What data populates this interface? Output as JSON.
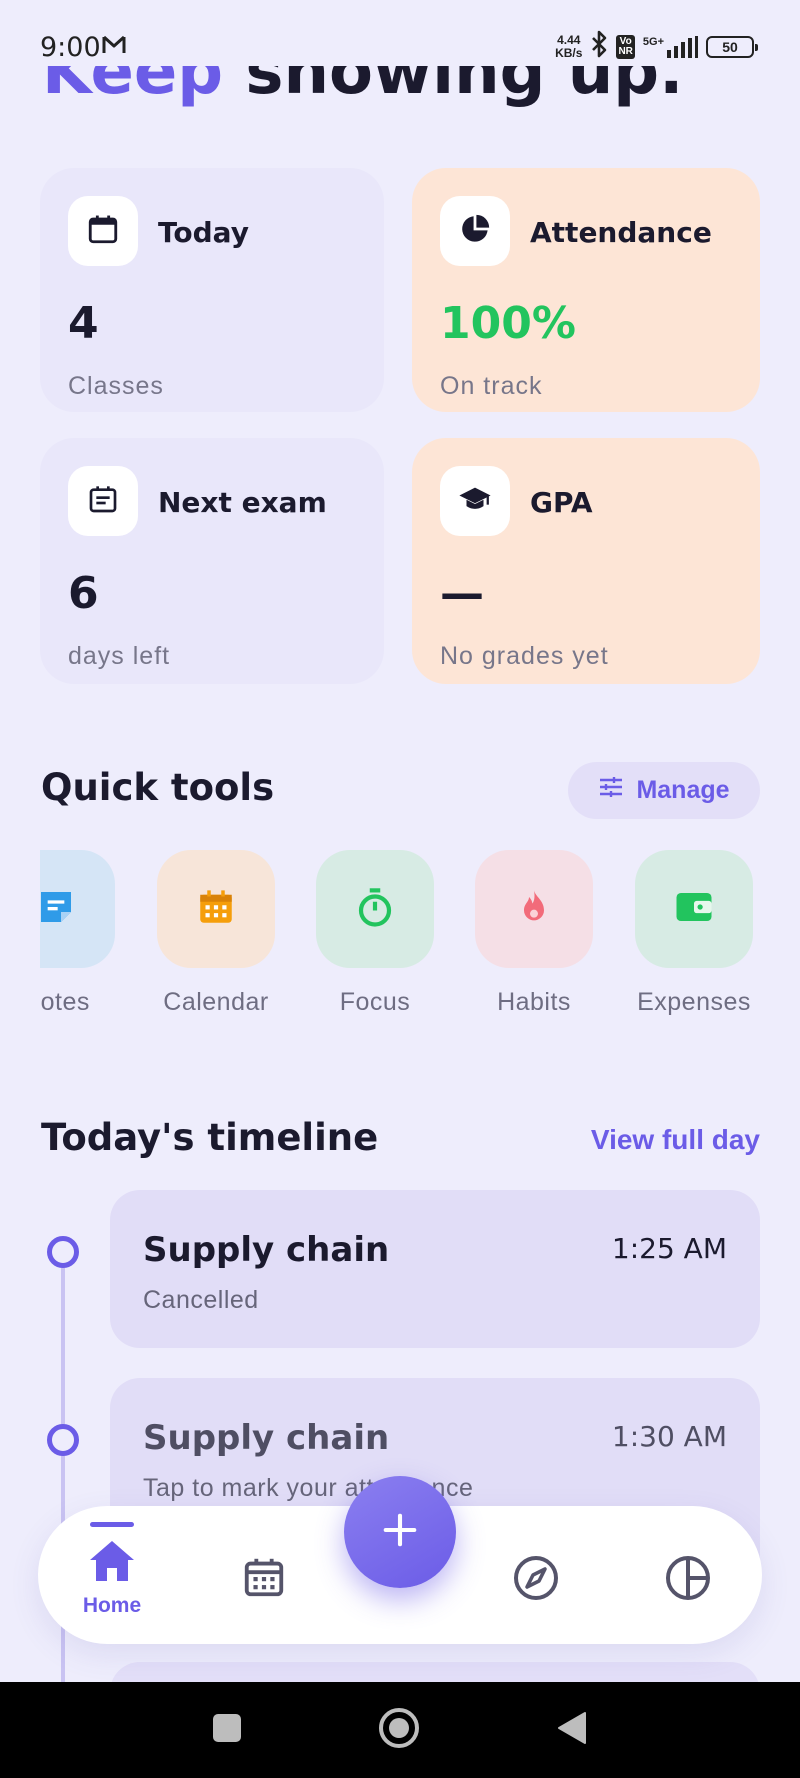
{
  "status_bar": {
    "time": "9:00",
    "net_speed_value": "4.44",
    "net_speed_unit": "KB/s",
    "volte_top": "Vo",
    "volte_bottom": "NR",
    "network_type": "5G+",
    "battery": "50"
  },
  "hero": {
    "accent_text": "Keep",
    "rest_text": " showing up."
  },
  "stats": [
    {
      "title": "Today",
      "value": "4",
      "subtitle": "Classes",
      "icon": "calendar-icon"
    },
    {
      "title": "Attendance",
      "value": "100%",
      "subtitle": "On track",
      "icon": "pie-chart-icon",
      "value_color": "#22c45e"
    },
    {
      "title": "Next exam",
      "value": "6",
      "subtitle": "days left",
      "icon": "event-note-icon"
    },
    {
      "title": "GPA",
      "value": "—",
      "subtitle": "No grades yet",
      "icon": "graduation-cap-icon"
    }
  ],
  "quick_tools": {
    "title": "Quick tools",
    "manage_label": "Manage",
    "items": [
      {
        "label": "Notes",
        "icon": "notes-icon",
        "color": "#2f9be8"
      },
      {
        "label": "Calendar",
        "icon": "calendar-icon",
        "color": "#f59e0b"
      },
      {
        "label": "Focus",
        "icon": "timer-icon",
        "color": "#22c45e"
      },
      {
        "label": "Habits",
        "icon": "flame-icon",
        "color": "#f26b7a"
      },
      {
        "label": "Expenses",
        "icon": "wallet-icon",
        "color": "#22c45e"
      }
    ]
  },
  "timeline": {
    "title": "Today's timeline",
    "view_all_label": "View full day",
    "items": [
      {
        "title": "Supply chain",
        "time": "1:25 AM",
        "subtitle": "Cancelled"
      },
      {
        "title": "Supply chain",
        "time": "1:30 AM",
        "subtitle": "Tap to mark your attendance"
      }
    ]
  },
  "bottom_nav": {
    "items": [
      {
        "label": "Home",
        "icon": "home-icon",
        "active": true
      },
      {
        "label": "",
        "icon": "calendar-icon",
        "active": false
      },
      {
        "label": "",
        "icon": "compass-icon",
        "active": false
      },
      {
        "label": "",
        "icon": "pie-chart-icon",
        "active": false
      }
    ],
    "fab_icon": "plus-icon"
  },
  "colors": {
    "accent": "#6b5ce7",
    "background": "#eeedfc",
    "card_lavender": "#e9e7fa",
    "card_peach": "#fde5d6",
    "success": "#22c45e"
  }
}
